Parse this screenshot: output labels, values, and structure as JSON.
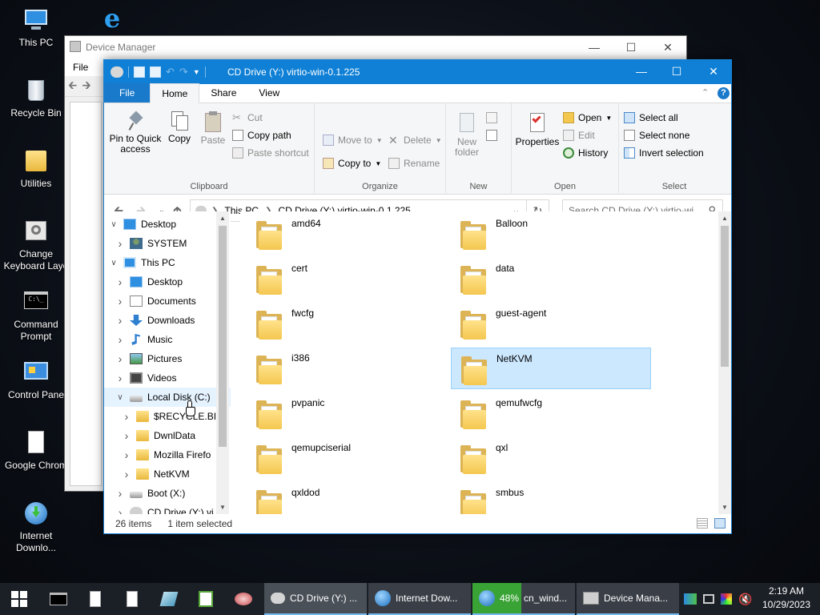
{
  "desktop": {
    "icons": [
      {
        "label": "This PC",
        "icon": "computer-icon"
      },
      {
        "label": "",
        "icon": "internet-explorer-icon"
      },
      {
        "label": "Recycle Bin",
        "icon": "recycle-bin-icon"
      },
      {
        "label": "Utilities",
        "icon": "folder-icon"
      },
      {
        "label": "Change Keyboard Layo",
        "icon": "keyboard-settings-icon"
      },
      {
        "label": "Command Prompt",
        "icon": "command-prompt-icon"
      },
      {
        "label": "Control Pane",
        "icon": "control-panel-icon"
      },
      {
        "label": "Google Chrom",
        "icon": "file-icon"
      },
      {
        "label": "Internet Downlo...",
        "icon": "internet-download-manager-icon"
      }
    ]
  },
  "device_manager": {
    "title": "Device Manager",
    "menu": [
      "File"
    ]
  },
  "explorer": {
    "title": "CD Drive (Y:) virtio-win-0.1.225",
    "tabs": [
      "File",
      "Home",
      "Share",
      "View"
    ],
    "active_tab": "Home",
    "ribbon": {
      "clipboard": {
        "label": "Clipboard",
        "pin": "Pin to Quick access",
        "copy": "Copy",
        "paste": "Paste",
        "cut": "Cut",
        "copy_path": "Copy path",
        "paste_shortcut": "Paste shortcut"
      },
      "organize": {
        "label": "Organize",
        "move_to": "Move to",
        "copy_to": "Copy to",
        "delete": "Delete",
        "rename": "Rename"
      },
      "new": {
        "label": "New",
        "new_folder": "New folder"
      },
      "open": {
        "label": "Open",
        "properties": "Properties",
        "open": "Open",
        "edit": "Edit",
        "history": "History"
      },
      "select": {
        "label": "Select",
        "select_all": "Select all",
        "select_none": "Select none",
        "invert": "Invert selection"
      }
    },
    "address": {
      "crumbs": [
        "This PC",
        "CD Drive (Y:) virtio-win-0.1.225"
      ],
      "search_placeholder": "Search CD Drive (Y:) virtio-wi..."
    },
    "nav": [
      {
        "label": "Desktop",
        "icon": "desktop-icon",
        "chev": "open"
      },
      {
        "label": "SYSTEM",
        "icon": "user-icon",
        "chev": "closed"
      },
      {
        "label": "This PC",
        "icon": "computer-icon",
        "chev": "open"
      },
      {
        "label": "Desktop",
        "icon": "desktop-icon",
        "chev": "closed"
      },
      {
        "label": "Documents",
        "icon": "documents-icon",
        "chev": "closed"
      },
      {
        "label": "Downloads",
        "icon": "downloads-icon",
        "chev": "closed"
      },
      {
        "label": "Music",
        "icon": "music-icon",
        "chev": "closed"
      },
      {
        "label": "Pictures",
        "icon": "pictures-icon",
        "chev": "closed"
      },
      {
        "label": "Videos",
        "icon": "videos-icon",
        "chev": "closed"
      },
      {
        "label": "Local Disk (C:)",
        "icon": "drive-icon",
        "chev": "open"
      },
      {
        "label": "$RECYCLE.BIN",
        "icon": "folder-icon",
        "chev": "closed"
      },
      {
        "label": "DwnlData",
        "icon": "folder-icon",
        "chev": "closed"
      },
      {
        "label": "Mozilla Firefo",
        "icon": "folder-icon",
        "chev": "closed"
      },
      {
        "label": "NetKVM",
        "icon": "folder-icon",
        "chev": "closed"
      },
      {
        "label": "Boot (X:)",
        "icon": "drive-icon",
        "chev": "closed"
      },
      {
        "label": "CD Drive (Y:) vi",
        "icon": "cd-drive-icon",
        "chev": "closed"
      }
    ],
    "folders": [
      "amd64",
      "Balloon",
      "cert",
      "data",
      "fwcfg",
      "guest-agent",
      "i386",
      "NetKVM",
      "pvpanic",
      "qemufwcfg",
      "qemupciserial",
      "qxl",
      "qxldod",
      "smbus"
    ],
    "selected_folder": "NetKVM",
    "status": {
      "count": "26 items",
      "selection": "1 item selected"
    }
  },
  "taskbar": {
    "buttons": [
      {
        "label": "CD Drive (Y:) ...",
        "icon": "cd-drive-icon"
      },
      {
        "label": "Internet Dow...",
        "icon": "internet-download-manager-icon"
      },
      {
        "label": "cn_wind...",
        "progress": "48%",
        "icon": "internet-download-manager-icon"
      },
      {
        "label": "Device Mana...",
        "icon": "device-manager-icon"
      }
    ],
    "clock": {
      "time": "2:19 AM",
      "date": "10/29/2023"
    }
  },
  "colors": {
    "accent": "#0f80d6",
    "selection": "#cce8ff",
    "folder": "#f4c74f",
    "download_progress": "#3aa335"
  }
}
